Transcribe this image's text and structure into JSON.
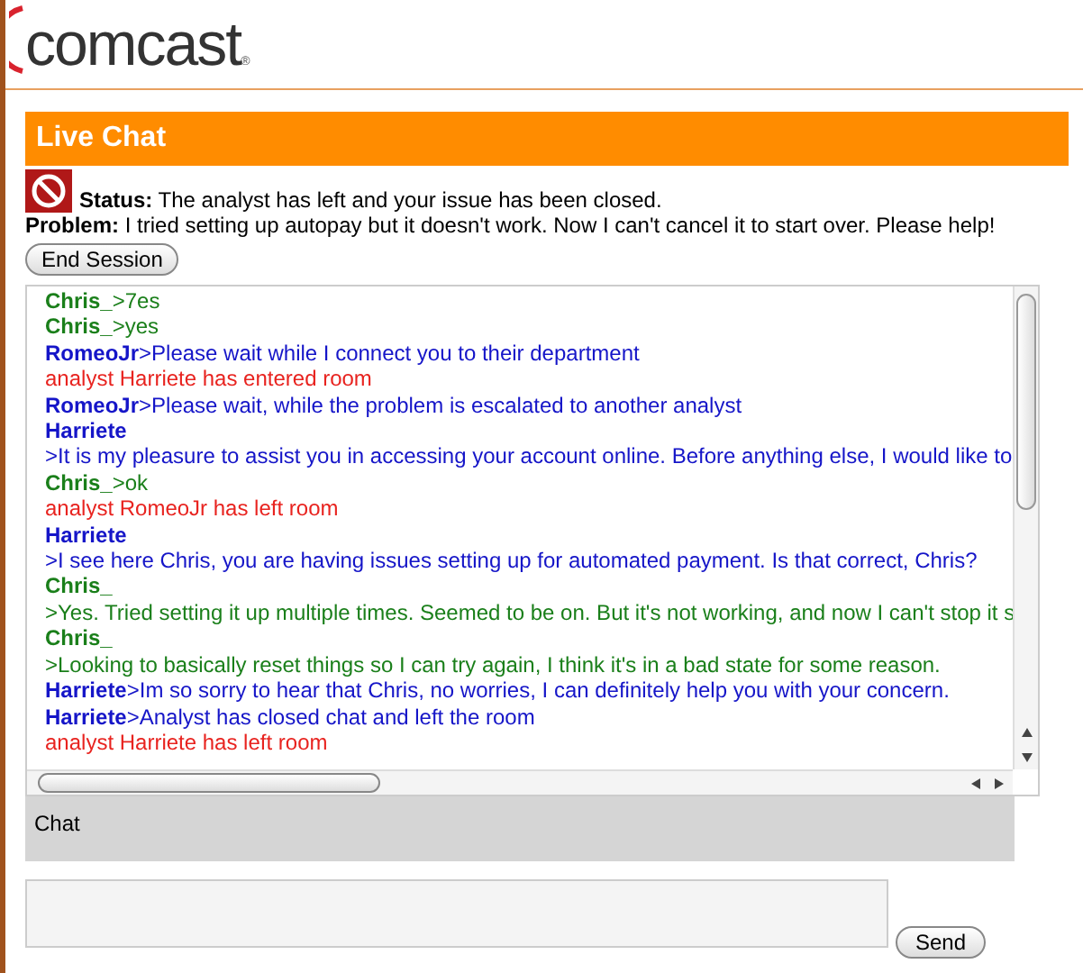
{
  "logo": {
    "text": "comcast",
    "mark": "®"
  },
  "header": {
    "title": "Live Chat"
  },
  "status": {
    "label": "Status:",
    "text": "The analyst has left and your issue has been closed."
  },
  "problem": {
    "label": "Problem:",
    "text": "I tried setting up autopay but it doesn't work. Now I can't cancel it to start over. Please help!"
  },
  "end_button": "End Session",
  "messages": [
    {
      "kind": "inline",
      "color": "#1a7f1a",
      "sender": "Chris_",
      "text": ">7es"
    },
    {
      "kind": "inline",
      "color": "#1a7f1a",
      "sender": "Chris_",
      "text": ">yes"
    },
    {
      "kind": "inline",
      "color": "#1515c8",
      "sender": "RomeoJr",
      "text": ">Please wait while I connect you to their department"
    },
    {
      "kind": "system",
      "color": "#e8231f",
      "text": "analyst Harriete has entered room"
    },
    {
      "kind": "inline",
      "color": "#1515c8",
      "sender": "RomeoJr",
      "text": ">Please wait, while the problem is escalated to another analyst"
    },
    {
      "kind": "block",
      "color": "#1515c8",
      "sender": "Harriete",
      "text": ">It is my pleasure to assist you in accessing your account online. Before anything else, I would like to"
    },
    {
      "kind": "inline",
      "color": "#1a7f1a",
      "sender": "Chris_",
      "text": ">ok"
    },
    {
      "kind": "system",
      "color": "#e8231f",
      "text": "analyst RomeoJr has left room"
    },
    {
      "kind": "block",
      "color": "#1515c8",
      "sender": "Harriete",
      "text": ">I see here Chris, you are having issues setting up for automated payment. Is that correct, Chris?"
    },
    {
      "kind": "block",
      "color": "#1a7f1a",
      "sender": "Chris_",
      "text": ">Yes. Tried setting it up multiple times. Seemed to be on. But it's not working, and now I can't stop it s"
    },
    {
      "kind": "block",
      "color": "#1a7f1a",
      "sender": "Chris_",
      "text": ">Looking to basically reset things so I can try again, I think it's in a bad state for some reason."
    },
    {
      "kind": "inline",
      "color": "#1515c8",
      "sender": "Harriete",
      "text": ">Im so sorry to hear that Chris, no worries, I can definitely help you with your concern."
    },
    {
      "kind": "inline",
      "color": "#1515c8",
      "sender": "Harriete",
      "text": ">Analyst has closed chat and left the room"
    },
    {
      "kind": "system",
      "color": "#e8231f",
      "text": "analyst Harriete has left room"
    }
  ],
  "chat_label": "Chat",
  "send_button": "Send"
}
